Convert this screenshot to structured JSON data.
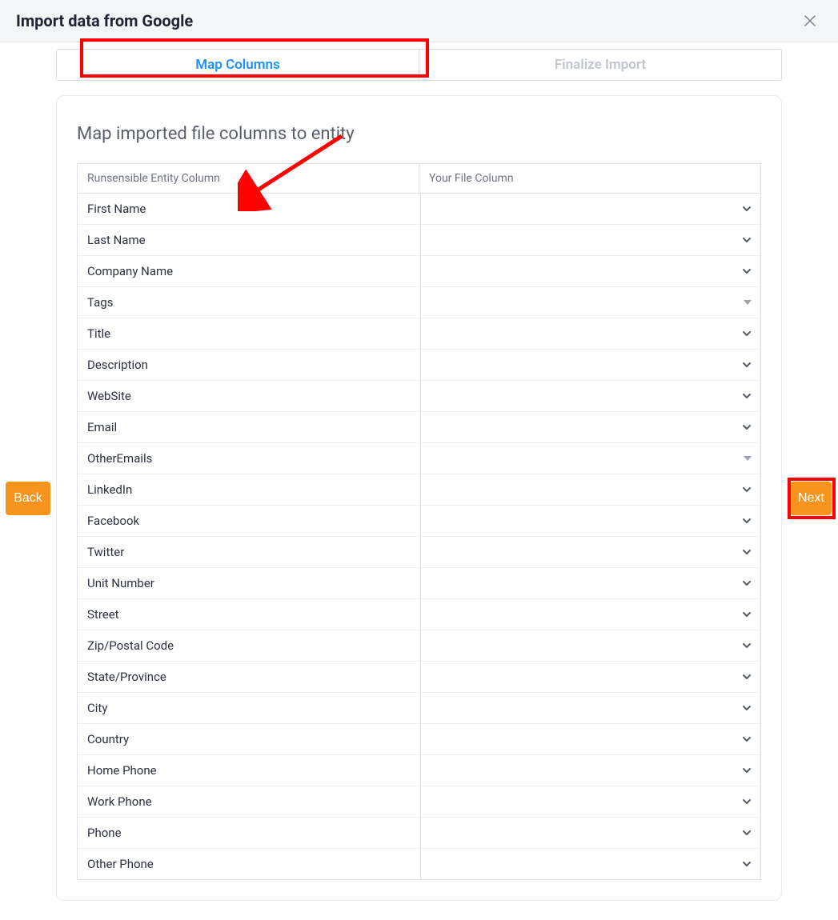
{
  "header": {
    "title": "Import data from Google"
  },
  "tabs": {
    "active": "Map Columns",
    "inactive": "Finalize Import"
  },
  "section_title": "Map imported file columns to entity",
  "table": {
    "header_left": "Runsensible Entity Column",
    "header_right": "Your File Column",
    "rows": [
      {
        "label": "First Name",
        "kind": "chev"
      },
      {
        "label": "Last Name",
        "kind": "chev"
      },
      {
        "label": "Company Name",
        "kind": "chev"
      },
      {
        "label": "Tags",
        "kind": "tri"
      },
      {
        "label": "Title",
        "kind": "chev"
      },
      {
        "label": "Description",
        "kind": "chev"
      },
      {
        "label": "WebSite",
        "kind": "chev"
      },
      {
        "label": "Email",
        "kind": "chev"
      },
      {
        "label": "OtherEmails",
        "kind": "tri"
      },
      {
        "label": "LinkedIn",
        "kind": "chev"
      },
      {
        "label": "Facebook",
        "kind": "chev"
      },
      {
        "label": "Twitter",
        "kind": "chev"
      },
      {
        "label": "Unit Number",
        "kind": "chev"
      },
      {
        "label": "Street",
        "kind": "chev"
      },
      {
        "label": "Zip/Postal Code",
        "kind": "chev"
      },
      {
        "label": "State/Province",
        "kind": "chev"
      },
      {
        "label": "City",
        "kind": "chev"
      },
      {
        "label": "Country",
        "kind": "chev"
      },
      {
        "label": "Home Phone",
        "kind": "chev"
      },
      {
        "label": "Work Phone",
        "kind": "chev"
      },
      {
        "label": "Phone",
        "kind": "chev"
      },
      {
        "label": "Other Phone",
        "kind": "chev"
      }
    ]
  },
  "buttons": {
    "back": "Back",
    "next": "Next"
  },
  "annotations": {
    "tab_highlight": true,
    "arrow": true,
    "next_highlight": true
  }
}
